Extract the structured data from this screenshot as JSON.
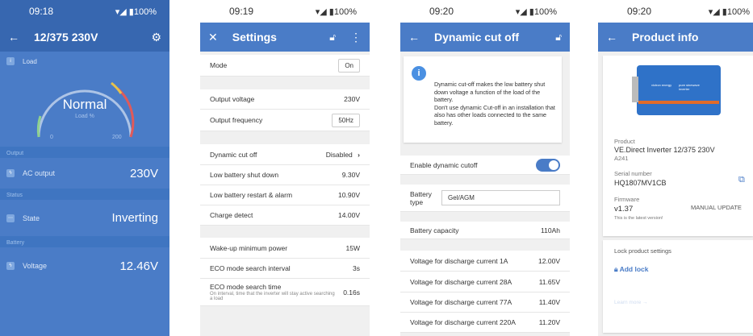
{
  "p1": {
    "time": "09:18",
    "signal": "▾◢ ▮",
    "battery": "100%",
    "title": "12/375 230V",
    "load_label": "Load",
    "gauge_main": "Normal",
    "gauge_sub": "Load %",
    "gauge_min": "0",
    "gauge_max": "200",
    "gauge_level": 0.4,
    "output_section": "Output",
    "ac_label": "AC output",
    "ac_value": "230V",
    "status_section": "Status",
    "state_label": "State",
    "state_value": "Inverting",
    "battery_section": "Battery",
    "voltage_label": "Voltage",
    "voltage_value": "12.46V",
    "colors": {
      "bg": "#4a7cc7",
      "bar": "#3767b0",
      "section": "#3f75c1"
    }
  },
  "p2": {
    "time": "09:19",
    "battery": "100%",
    "title": "Settings",
    "mode_label": "Mode",
    "mode_value": "On",
    "out_v_label": "Output voltage",
    "out_v_value": "230V",
    "out_f_label": "Output frequency",
    "out_f_value": "50Hz",
    "dyn_label": "Dynamic cut off",
    "dyn_value": "Disabled",
    "lbs_label": "Low battery shut down",
    "lbs_value": "9.30V",
    "lbr_label": "Low battery restart & alarm",
    "lbr_value": "10.90V",
    "cd_label": "Charge detect",
    "cd_value": "14.00V",
    "wu_label": "Wake-up minimum power",
    "wu_value": "15W",
    "eco_int_label": "ECO mode search interval",
    "eco_int_value": "3s",
    "eco_time_label": "ECO mode search time",
    "eco_time_desc": "On interval, time that the inverter will stay active searching a load",
    "eco_time_value": "0.16s"
  },
  "p3": {
    "time": "09:20",
    "battery": "100%",
    "title": "Dynamic cut off",
    "info_text": "Dynamic cut-off makes the low battery shut down voltage a function of the load of the battery.\nDon't use dynamic Cut-off in an installation that also has other loads connected to the same battery.",
    "enable_label": "Enable dynamic cutoff",
    "enable_on": true,
    "bt_label": "Battery type",
    "bt_value": "Gel/AGM",
    "cap_label": "Battery capacity",
    "cap_value": "110Ah",
    "d1_label": "Voltage for discharge current 1A",
    "d1_value": "12.00V",
    "d2_label": "Voltage for discharge current 28A",
    "d2_value": "11.65V",
    "d3_label": "Voltage for discharge current 77A",
    "d3_value": "11.40V",
    "d4_label": "Voltage for discharge current 220A",
    "d4_value": "11.20V"
  },
  "p4": {
    "time": "09:20",
    "battery": "100%",
    "title": "Product info",
    "device_brand": "victron energy",
    "device_model": "pure sinewave inverter",
    "product_label": "Product",
    "product_value": "VE.Direct Inverter 12/375 230V",
    "product_code": "A241",
    "serial_label": "Serial number",
    "serial_value": "HQ1807MV1CB",
    "fw_label": "Firmware",
    "fw_value": "v1.37",
    "fw_btn": "MANUAL UPDATE",
    "fw_note": "This is the latest version!",
    "lock_title": "Lock product settings",
    "add_lock": "Add lock",
    "learn_more": "Learn more →"
  }
}
